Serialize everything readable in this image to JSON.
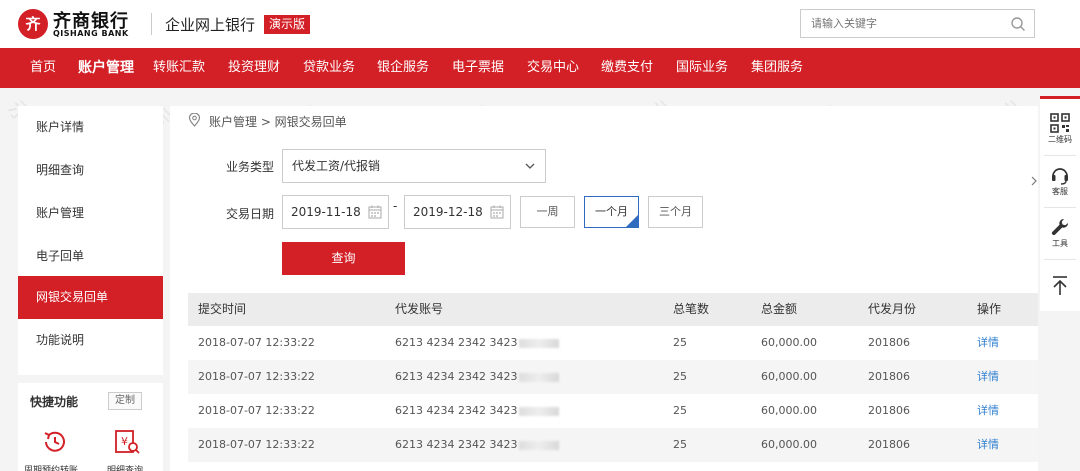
{
  "header": {
    "logo_glyph": "齐",
    "bank_name": "齐商银行",
    "bank_name_en": "QISHANG BANK",
    "portal_title": "企业网上银行",
    "demo_badge": "演示版",
    "search_placeholder": "请输入关键字"
  },
  "nav": {
    "items": [
      {
        "label": "首页"
      },
      {
        "label": "账户管理",
        "active": true
      },
      {
        "label": "转账汇款"
      },
      {
        "label": "投资理财"
      },
      {
        "label": "贷款业务"
      },
      {
        "label": "银企服务"
      },
      {
        "label": "电子票据"
      },
      {
        "label": "交易中心"
      },
      {
        "label": "缴费支付"
      },
      {
        "label": "国际业务"
      },
      {
        "label": "集团服务"
      }
    ]
  },
  "sidebar": {
    "items": [
      {
        "label": "账户详情"
      },
      {
        "label": "明细查询"
      },
      {
        "label": "账户管理"
      },
      {
        "label": "电子回单"
      },
      {
        "label": "网银交易回单",
        "active": true
      },
      {
        "label": "功能说明"
      }
    ],
    "quick": {
      "title": "快捷功能",
      "customize_label": "定制",
      "items": [
        {
          "label": "周期预约转账",
          "icon": "clock-refresh-icon"
        },
        {
          "label": "明细查询",
          "icon": "yuan-search-icon"
        }
      ]
    }
  },
  "breadcrumb": {
    "text": "账户管理 > 网银交易回单"
  },
  "form": {
    "business_type_label": "业务类型",
    "business_type_value": "代发工资/代报销",
    "date_label": "交易日期",
    "date_from": "2019-11-18",
    "date_separator": "-",
    "date_to": "2019-12-18",
    "ranges": [
      {
        "label": "一周"
      },
      {
        "label": "一个月",
        "active": true
      },
      {
        "label": "三个月"
      }
    ],
    "query_label": "查询"
  },
  "table": {
    "headers": [
      "提交时间",
      "代发账号",
      "总笔数",
      "总金额",
      "代发月份",
      "操作"
    ],
    "rows": [
      {
        "time": "2018-07-07 12:33:22",
        "account": "6213 4234 2342 3423",
        "count": "25",
        "amount": "60,000.00",
        "month": "201806",
        "action": "详情"
      },
      {
        "time": "2018-07-07 12:33:22",
        "account": "6213 4234 2342 3423",
        "count": "25",
        "amount": "60,000.00",
        "month": "201806",
        "action": "详情"
      },
      {
        "time": "2018-07-07 12:33:22",
        "account": "6213 4234 2342 3423",
        "count": "25",
        "amount": "60,000.00",
        "month": "201806",
        "action": "详情"
      },
      {
        "time": "2018-07-07 12:33:22",
        "account": "6213 4234 2342 3423",
        "count": "25",
        "amount": "60,000.00",
        "month": "201806",
        "action": "详情"
      }
    ]
  },
  "float_bar": {
    "items": [
      {
        "label": "二维码",
        "icon": "qr-code-icon"
      },
      {
        "label": "客服",
        "icon": "headset-icon"
      },
      {
        "label": "工具",
        "icon": "wrench-icon"
      },
      {
        "label": "",
        "icon": "back-to-top-icon"
      }
    ]
  },
  "colors": {
    "brand_red": "#d31f26",
    "link_blue": "#2f7fd0",
    "selected_blue": "#2f6bbf"
  }
}
